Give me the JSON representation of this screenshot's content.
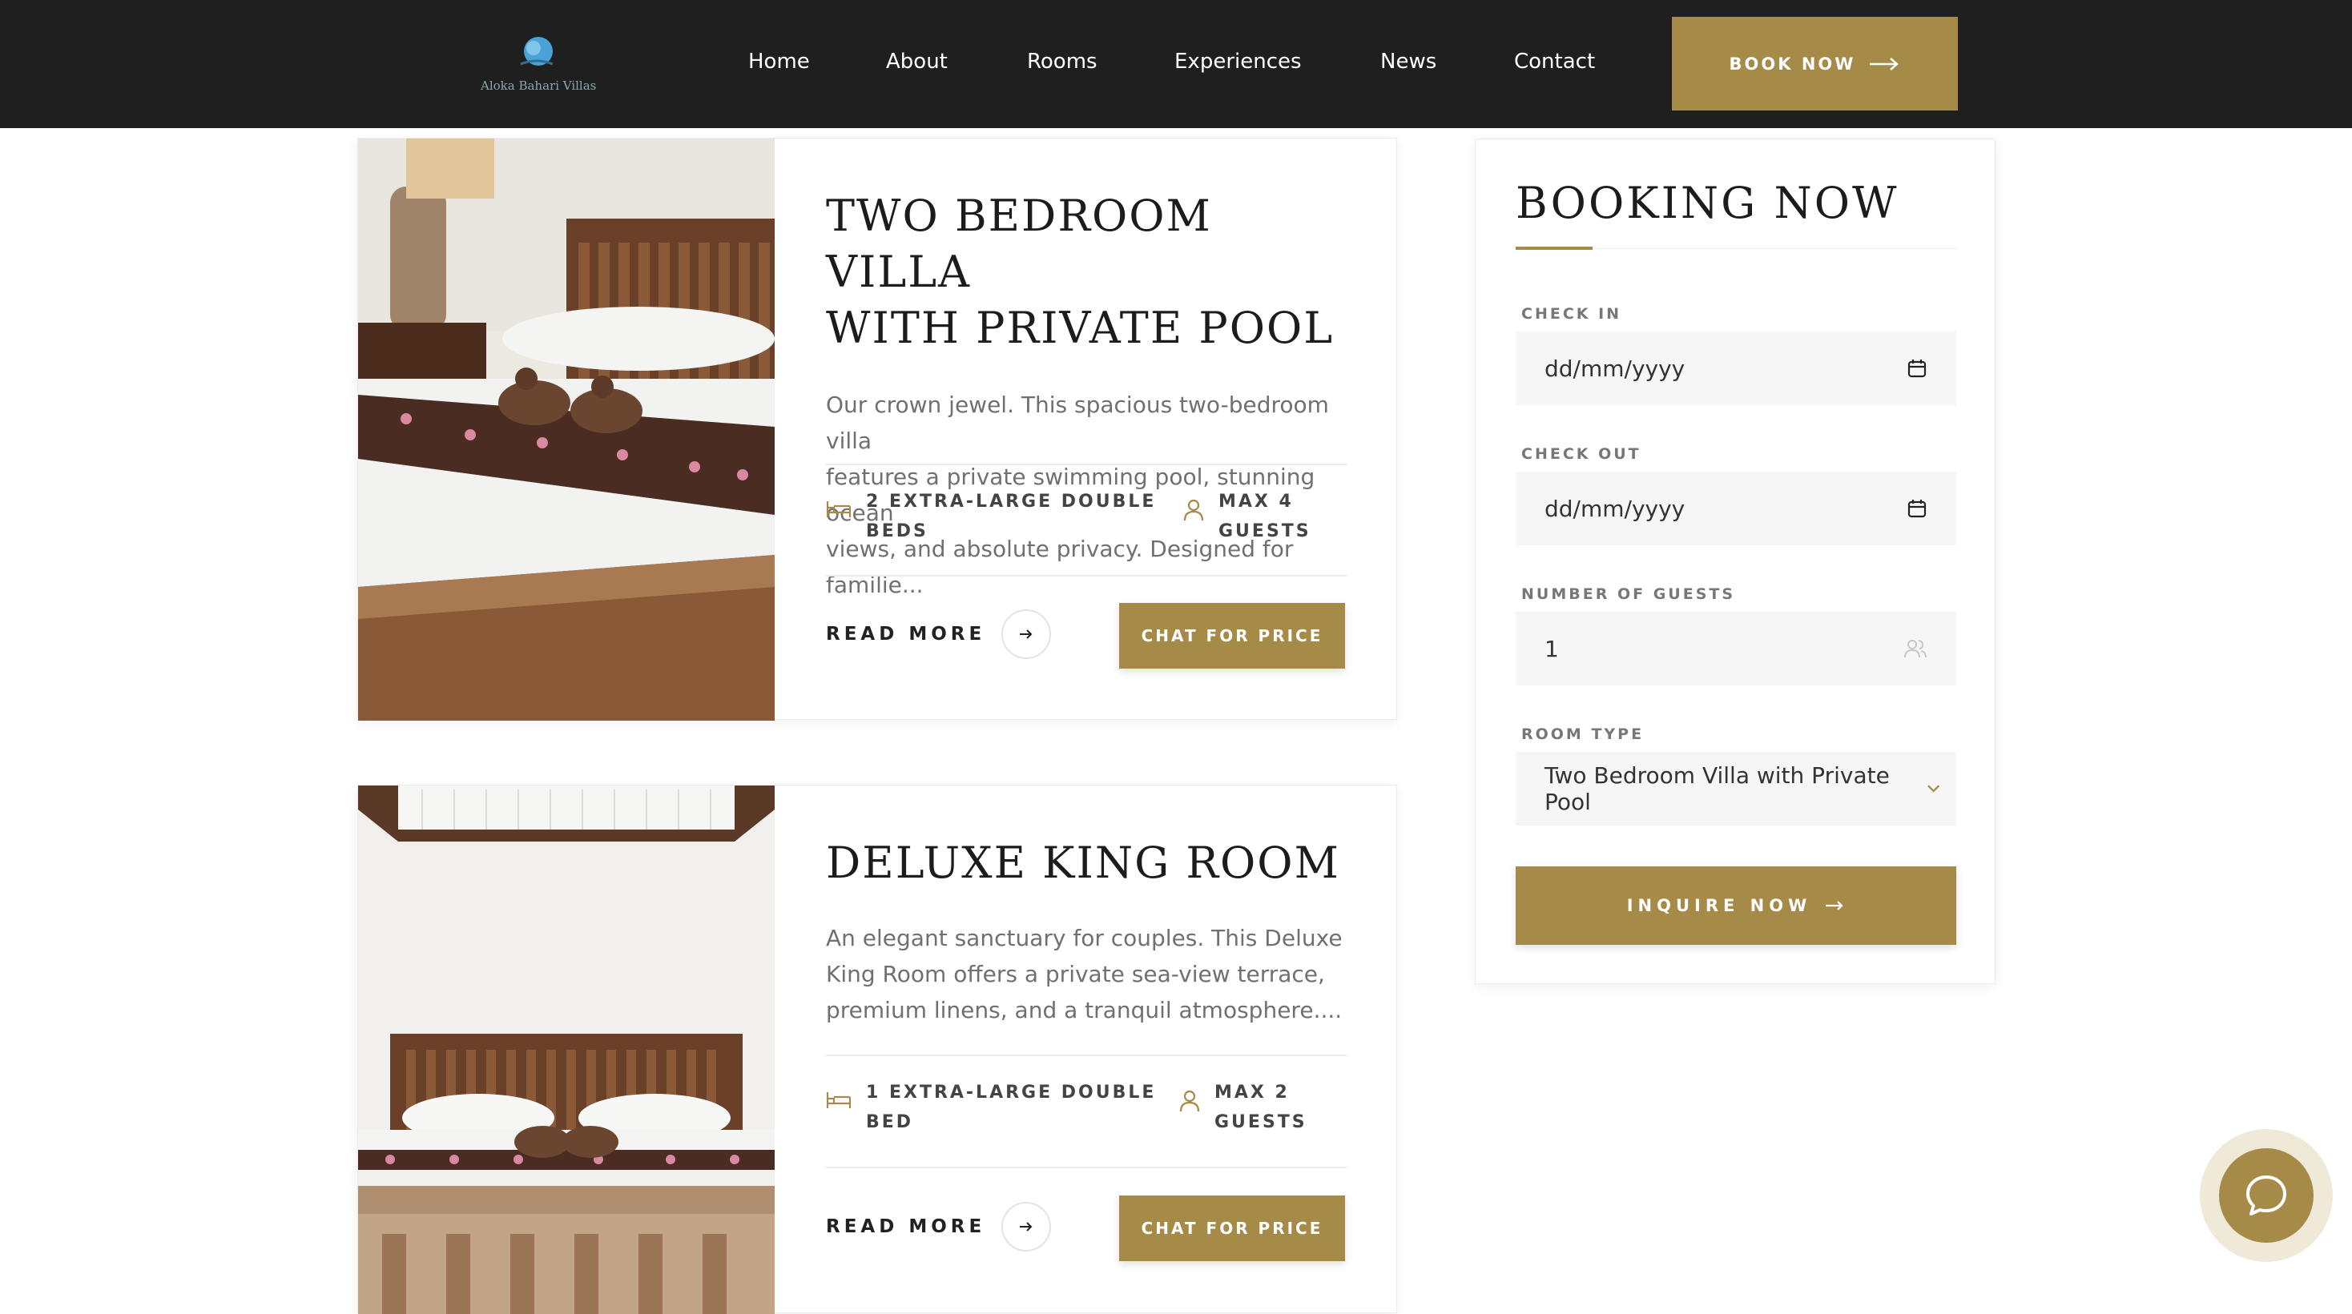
{
  "header": {
    "logo_text": "Aloka Bahari Villas",
    "nav": [
      "Home",
      "About",
      "Rooms",
      "Experiences",
      "News",
      "Contact"
    ],
    "book_now": "BOOK NOW"
  },
  "rooms": [
    {
      "title_line1": "TWO BEDROOM VILLA",
      "title_line2": "WITH PRIVATE POOL",
      "desc_lines": [
        "Our crown jewel. This spacious two-bedroom villa",
        "features a private swimming pool, stunning ocean",
        "views, and absolute privacy. Designed for familie..."
      ],
      "beds_line1": "2 EXTRA-LARGE DOUBLE",
      "beds_line2": "BEDS",
      "guests_line1": "MAX 4",
      "guests_line2": "GUESTS",
      "read_more": "READ MORE",
      "chat_price": "CHAT FOR PRICE"
    },
    {
      "title_line1": "DELUXE KING ROOM",
      "desc_lines": [
        "An elegant sanctuary for couples. This Deluxe",
        "King Room offers a private sea-view terrace,",
        "premium linens, and a tranquil atmosphere...."
      ],
      "beds_line1": "1 EXTRA-LARGE DOUBLE",
      "beds_line2": "BED",
      "guests_line1": "MAX 2",
      "guests_line2": "GUESTS",
      "read_more": "READ MORE",
      "chat_price": "CHAT FOR PRICE"
    }
  ],
  "booking": {
    "title": "BOOKING NOW",
    "check_in_label": "CHECK IN",
    "check_in_value": "dd/mm/yyyy",
    "check_out_label": "CHECK OUT",
    "check_out_value": "dd/mm/yyyy",
    "guests_label": "NUMBER OF GUESTS",
    "guests_value": "1",
    "room_type_label": "ROOM TYPE",
    "room_type_value": "Two Bedroom Villa with Private Pool",
    "inquire": "INQUIRE NOW"
  },
  "colors": {
    "accent": "#a58a48",
    "header_bg": "#1f1f1f",
    "field_bg": "#f6f6f6"
  },
  "icons": {
    "calendar": "calendar-icon",
    "bed": "bed-icon",
    "person": "person-icon",
    "users": "users-icon",
    "arrow": "arrow-right-icon",
    "chevron": "chevron-down-icon",
    "chat": "chat-bubble-icon"
  }
}
